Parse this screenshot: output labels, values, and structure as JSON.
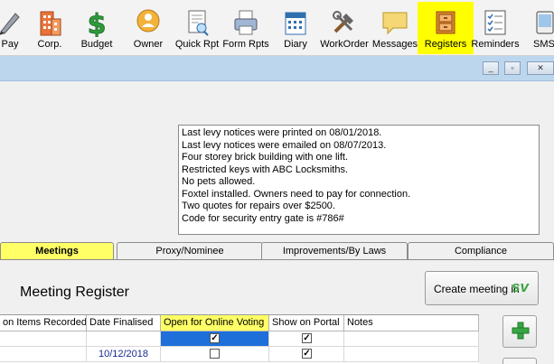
{
  "toolbar": {
    "items": [
      {
        "label": "Pay",
        "icon": "pen-icon"
      },
      {
        "label": "Corp.",
        "icon": "building-icon"
      },
      {
        "label": "Budget",
        "icon": "dollar-icon"
      },
      {
        "label": "Owner",
        "icon": "owner-icon"
      },
      {
        "label": "Quick Rpt",
        "icon": "quick-report-icon"
      },
      {
        "label": "Form Rpts",
        "icon": "printer-icon"
      },
      {
        "label": "Diary",
        "icon": "calendar-icon"
      },
      {
        "label": "WorkOrder",
        "icon": "tools-icon"
      },
      {
        "label": "Messages",
        "icon": "speech-bubble-icon"
      },
      {
        "label": "Registers",
        "icon": "registers-icon"
      },
      {
        "label": "Reminders",
        "icon": "checklist-icon"
      },
      {
        "label": "SMS",
        "icon": "sms-icon"
      }
    ]
  },
  "window": {
    "min_glyph": "_",
    "restore_glyph": "▫",
    "close_glyph": "✕"
  },
  "notes": {
    "lines": [
      "Last levy notices were printed on 08/01/2018.",
      "Last levy notices were emailed on 08/07/2013.",
      "Four storey brick building with one lift.",
      "Restricted keys with ABC Locksmiths.",
      "No pets allowed.",
      "Foxtel installed. Owners need to pay for connection.",
      "Two quotes for repairs over $2500.",
      "Code for security entry gate is #786#"
    ]
  },
  "tabs": [
    {
      "label": "Meetings",
      "active": true
    },
    {
      "label": "Proxy/Nominee",
      "active": false
    },
    {
      "label": "Improvements/By Laws",
      "active": false
    },
    {
      "label": "Compliance",
      "active": false
    }
  ],
  "register": {
    "title": "Meeting Register",
    "create_button": "Create meeting in",
    "create_logo": "sv"
  },
  "grid": {
    "columns": [
      "on Items Recorded",
      "Date Finalised",
      "Open for Online Voting",
      "Show on Portal",
      "Notes"
    ],
    "rows": [
      {
        "date_finalised": "",
        "online_voting": true,
        "show_on_portal": true,
        "notes": ""
      },
      {
        "date_finalised": "10/12/2018",
        "online_voting": false,
        "show_on_portal": true,
        "notes": ""
      }
    ]
  },
  "colors": {
    "highlight": "#ffff00",
    "title_bar": "#bcd6ee",
    "selected_cell": "#1e6fd9",
    "date_text": "#1a2a8c",
    "sv_logo": "#3aa544"
  }
}
